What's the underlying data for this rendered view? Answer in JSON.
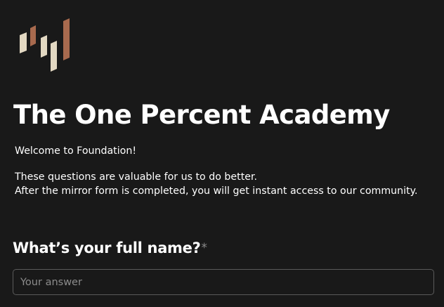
{
  "form": {
    "title": "The One Percent Academy",
    "description": {
      "welcome": "Welcome to Foundation!",
      "line1": "These questions are valuable for us to do better.",
      "line2": "After the mirror form is completed, you will get instant access to our community."
    },
    "questions": [
      {
        "label": "What’s your full name?",
        "required_mark": "*",
        "placeholder": "Your answer",
        "value": ""
      }
    ]
  },
  "logo": {
    "icon": "ascending-bars-logo",
    "colors": [
      "#e2d8c2",
      "#a86a4e",
      "#e2d8c2",
      "#e2d8c2",
      "#a86a4e"
    ]
  },
  "theme": {
    "background": "#191919",
    "text": "#ffffff",
    "muted": "#8c8c8c",
    "input_border": "#5a5a5a"
  }
}
